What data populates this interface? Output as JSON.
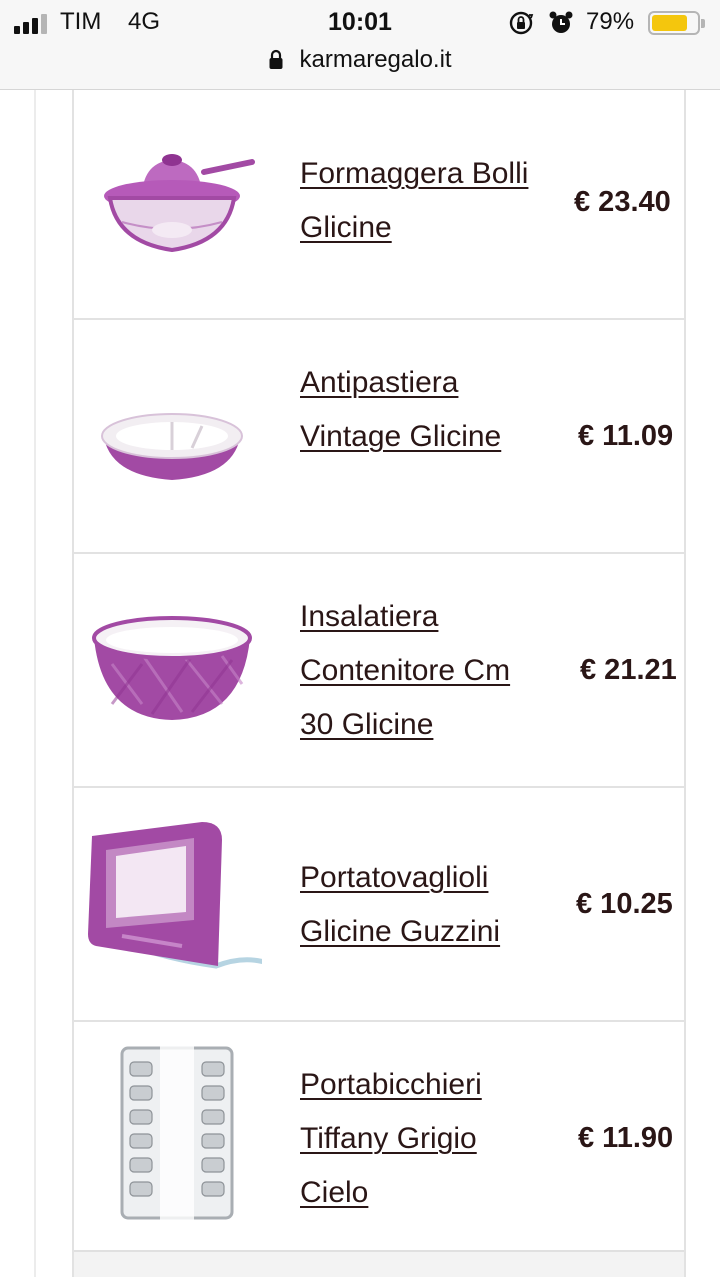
{
  "status_bar": {
    "carrier": "TIM",
    "network": "4G",
    "time": "10:01",
    "battery_percent": "79%",
    "battery_level": 0.79,
    "signal_bars": 3,
    "signal_total": 4,
    "battery_color": "#f4c60d"
  },
  "url_bar": {
    "domain": "karmaregalo.it",
    "icon": "lock-icon"
  },
  "products": [
    {
      "name": "Formaggera Bolli Glicine",
      "price": "€ 23.40",
      "thumbnail": "sugar-bowl-icon"
    },
    {
      "name": "Antipastiera Vintage Glicine",
      "price": "€ 11.09",
      "thumbnail": "serving-dish-icon"
    },
    {
      "name": "Insalatiera Contenitore Cm 30 Glicine",
      "price": "€ 21.21",
      "thumbnail": "salad-bowl-icon"
    },
    {
      "name": "Portatovaglioli Glicine Guzzini",
      "price": "€ 10.25",
      "thumbnail": "napkin-holder-icon"
    },
    {
      "name": "Portabicchieri Tiffany Grigio Cielo",
      "price": "€ 11.90",
      "thumbnail": "glass-holder-icon"
    }
  ],
  "colors": {
    "accent_purple": "#a24aa4",
    "text_dark": "#2a1616"
  }
}
